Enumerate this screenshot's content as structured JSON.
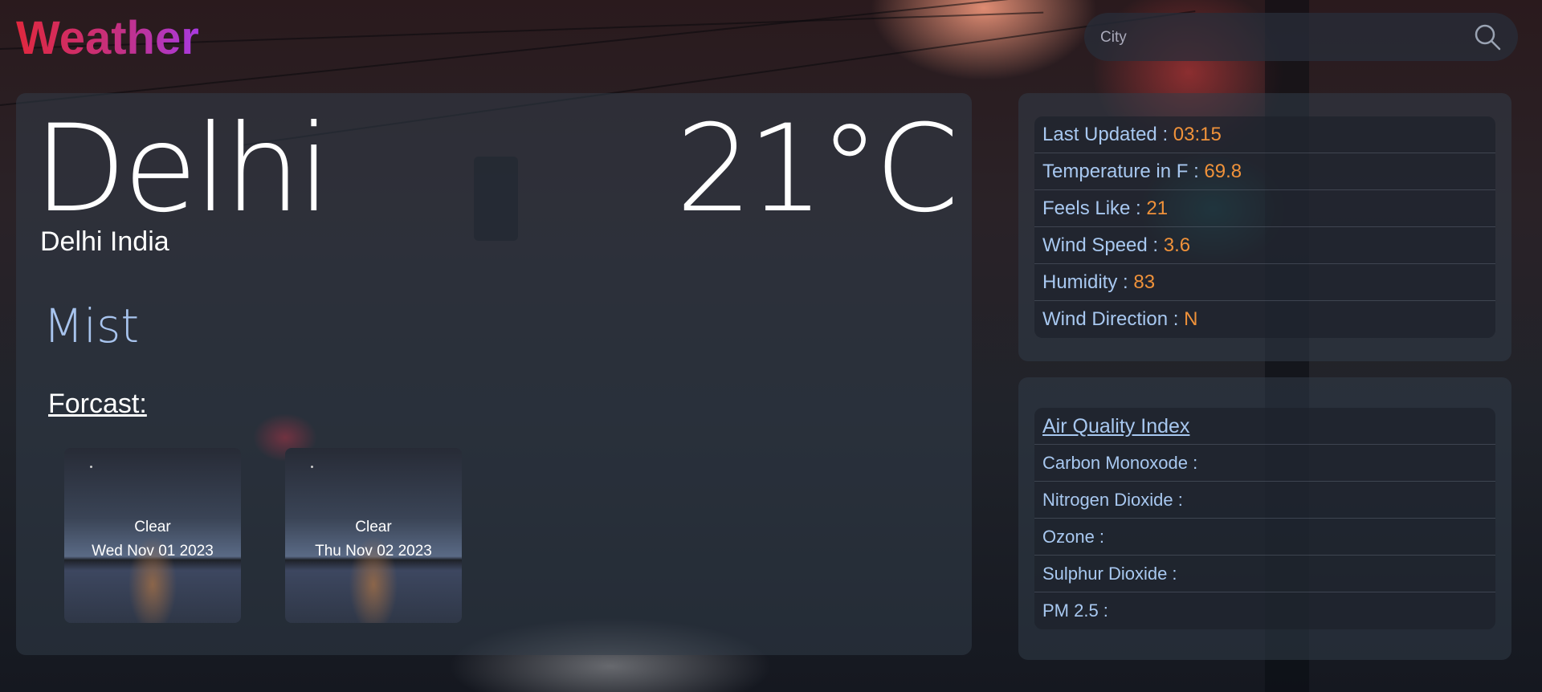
{
  "app": {
    "title": "Weather"
  },
  "search": {
    "placeholder": "City"
  },
  "current": {
    "city": "Delhi",
    "location": "Delhi India",
    "temperature": "21°C",
    "condition": "Mist"
  },
  "forecast": {
    "title": "Forcast:",
    "days": [
      {
        "condition": "Clear",
        "date": "Wed Nov 01 2023"
      },
      {
        "condition": "Clear",
        "date": "Thu Nov 02 2023"
      }
    ]
  },
  "details": [
    {
      "label": "Last Updated : ",
      "value": "03:15"
    },
    {
      "label": "Temperature in F : ",
      "value": "69.8"
    },
    {
      "label": "Feels Like : ",
      "value": "21"
    },
    {
      "label": "Wind Speed : ",
      "value": "3.6"
    },
    {
      "label": "Humidity : ",
      "value": "83"
    },
    {
      "label": "Wind Direction : ",
      "value": "N"
    }
  ],
  "aqi": {
    "title": "Air Quality Index",
    "items": [
      {
        "label": "Carbon Monoxode : ",
        "value": ""
      },
      {
        "label": "Nitrogen Dioxide : ",
        "value": ""
      },
      {
        "label": "Ozone : ",
        "value": ""
      },
      {
        "label": "Sulphur Dioxide : ",
        "value": ""
      },
      {
        "label": "PM 2.5 : ",
        "value": ""
      }
    ]
  },
  "colors": {
    "accent_value": "#f0923a",
    "label_blue": "#a8c8f0",
    "logo_gradient_start": "#e0283e",
    "logo_gradient_end": "#a83ae0"
  },
  "icons": {
    "search": "search-icon"
  }
}
